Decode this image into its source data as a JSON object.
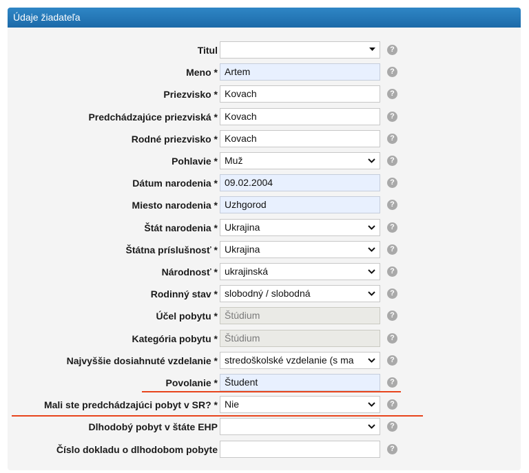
{
  "header": {
    "title": "Údaje žiadateľa"
  },
  "rows": [
    {
      "label": "Titul",
      "type": "select-tri",
      "value": ""
    },
    {
      "label": "Meno *",
      "type": "text-filled",
      "value": "Artem"
    },
    {
      "label": "Priezvisko *",
      "type": "text",
      "value": "Kovach"
    },
    {
      "label": "Predchádzajúce priezviská *",
      "type": "text",
      "value": "Kovach"
    },
    {
      "label": "Rodné priezvisko *",
      "type": "text",
      "value": "Kovach"
    },
    {
      "label": "Pohlavie *",
      "type": "select",
      "value": "Muž"
    },
    {
      "label": "Dátum narodenia *",
      "type": "text-filled",
      "value": "09.02.2004"
    },
    {
      "label": "Miesto narodenia *",
      "type": "text-filled",
      "value": "Uzhgorod"
    },
    {
      "label": "Štát narodenia *",
      "type": "select",
      "value": "Ukrajina"
    },
    {
      "label": "Štátna príslušnosť *",
      "type": "select",
      "value": "Ukrajina"
    },
    {
      "label": "Národnosť *",
      "type": "select",
      "value": "ukrajinská"
    },
    {
      "label": "Rodinný stav *",
      "type": "select",
      "value": "slobodný / slobodná"
    },
    {
      "label": "Účel pobytu *",
      "type": "readonly",
      "value": "Štúdium"
    },
    {
      "label": "Kategória pobytu *",
      "type": "readonly",
      "value": "Štúdium"
    },
    {
      "label": "Najvyššie dosiahnuté vzdelanie *",
      "type": "select",
      "value": "stredoškolské vzdelanie (s ma"
    },
    {
      "label": "Povolanie *",
      "type": "text-filled",
      "value": "Študent"
    },
    {
      "label": "Mali ste predchádzajúci pobyt v SR? *",
      "type": "select",
      "value": "Nie"
    },
    {
      "label": "Dlhodobý pobyt v štáte EHP",
      "type": "select",
      "value": ""
    },
    {
      "label": "Číslo dokladu o dlhodobom pobyte",
      "type": "text",
      "value": ""
    }
  ],
  "help_icon_glyph": "?",
  "accent_color": "#e8431b",
  "header_color": "#1c6aa8"
}
